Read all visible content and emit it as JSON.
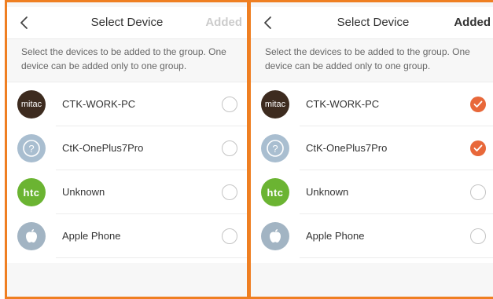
{
  "colors": {
    "accent_border": "#ef7f22",
    "check_fill": "#e8683a",
    "background": "#f7f7f7"
  },
  "screens": [
    {
      "header": {
        "back_icon": "chevron-left-icon",
        "title": "Select Device",
        "action_label": "Added",
        "action_enabled": false
      },
      "hint": "Select the devices to be added to the group. One device can be added only to one group.",
      "devices": [
        {
          "name": "CTK-WORK-PC",
          "avatar": "mitac",
          "avatar_text": "mitac",
          "selected": false
        },
        {
          "name": "CtK-OnePlus7Pro",
          "avatar": "question-icon",
          "avatar_text": "",
          "selected": false
        },
        {
          "name": "Unknown",
          "avatar": "htc",
          "avatar_text": "htc",
          "selected": false
        },
        {
          "name": "Apple Phone",
          "avatar": "apple-icon",
          "avatar_text": "",
          "selected": false
        }
      ]
    },
    {
      "header": {
        "back_icon": "chevron-left-icon",
        "title": "Select Device",
        "action_label": "Added",
        "action_enabled": true
      },
      "hint": "Select the devices to be added to the group. One device can be added only to one group.",
      "devices": [
        {
          "name": "CTK-WORK-PC",
          "avatar": "mitac",
          "avatar_text": "mitac",
          "selected": true
        },
        {
          "name": "CtK-OnePlus7Pro",
          "avatar": "question-icon",
          "avatar_text": "",
          "selected": true
        },
        {
          "name": "Unknown",
          "avatar": "htc",
          "avatar_text": "htc",
          "selected": false
        },
        {
          "name": "Apple Phone",
          "avatar": "apple-icon",
          "avatar_text": "",
          "selected": false
        }
      ]
    }
  ]
}
